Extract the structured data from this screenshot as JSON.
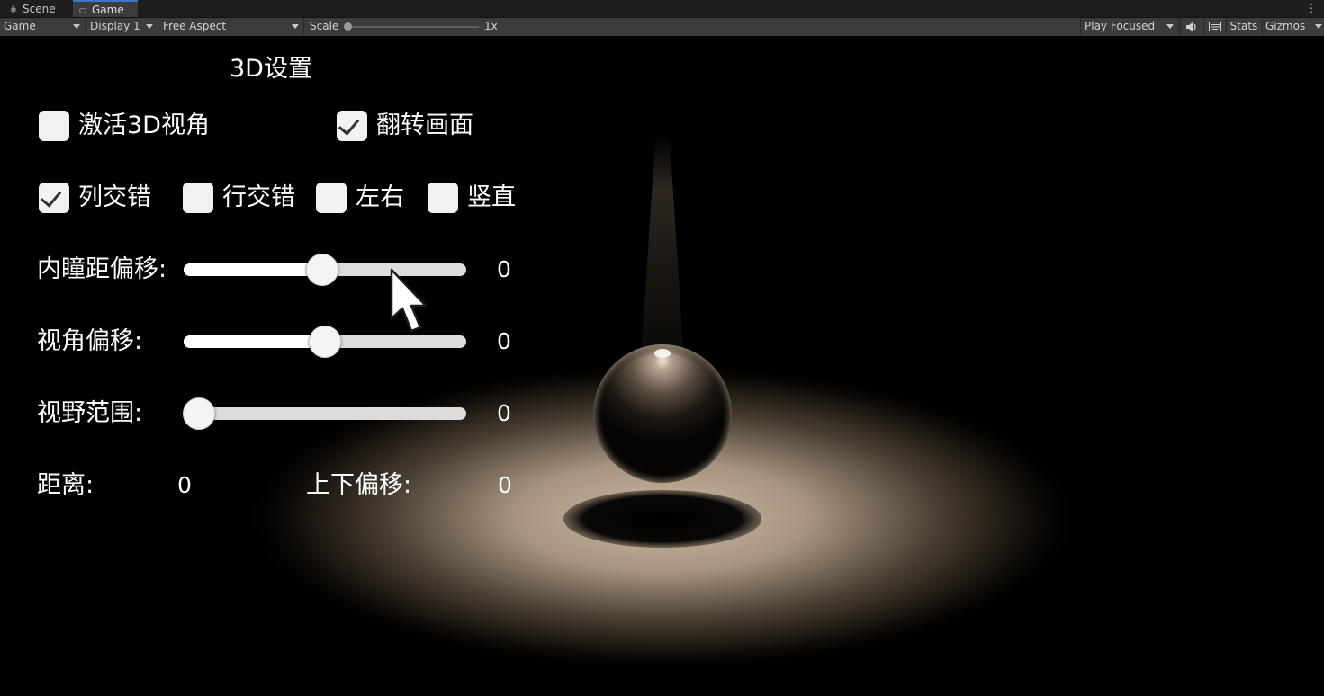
{
  "tabs": [
    {
      "label": "Scene",
      "icon": "grid-icon"
    },
    {
      "label": "Game",
      "icon": "gamepad-icon"
    }
  ],
  "toolbar": {
    "view_select": "Game",
    "display_select": "Display 1",
    "aspect_select": "Free Aspect",
    "scale_label": "Scale",
    "scale_value": "1x",
    "play_mode": "Play Focused",
    "audio_icon": "speaker-icon",
    "grid_icon": "keyboard-icon",
    "stats_label": "Stats",
    "gizmos_label": "Gizmos"
  },
  "settings": {
    "title": "3D设置",
    "activate_3d": {
      "label": "激活3D视角",
      "checked": false
    },
    "flip_screen": {
      "label": "翻转画面",
      "checked": true
    },
    "modes": [
      {
        "label": "列交错",
        "checked": true
      },
      {
        "label": "行交错",
        "checked": false
      },
      {
        "label": "左右",
        "checked": false
      },
      {
        "label": "竖直",
        "checked": false
      }
    ],
    "sliders": [
      {
        "label": "内瞳距偏移:",
        "value": "0",
        "fraction": 0.5
      },
      {
        "label": "视角偏移:",
        "value": "0",
        "fraction": 0.5
      },
      {
        "label": "视野范围:",
        "value": "0",
        "fraction": 0.0
      }
    ],
    "distance": {
      "label": "距离:",
      "value": "0"
    },
    "vertical_offset": {
      "label": "上下偏移:",
      "value": "0"
    }
  },
  "colors": {
    "accent": "#3a79bb",
    "toolbar_bg": "#3c3c3c",
    "tab_bg": "#1e1e1e",
    "spot_light": "#c9b39a"
  }
}
